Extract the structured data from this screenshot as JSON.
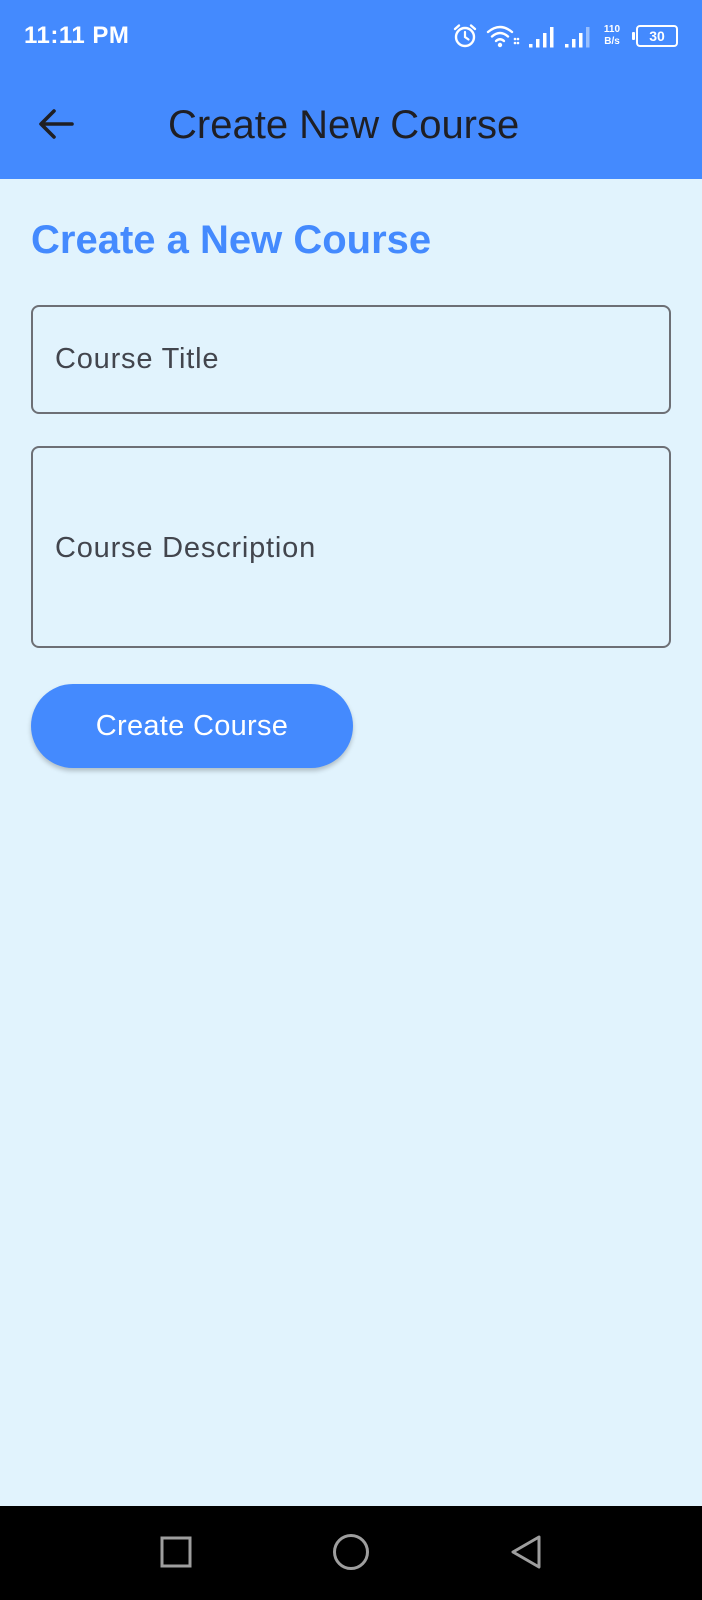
{
  "status_bar": {
    "time": "11:11 PM",
    "net_speed_value": "110",
    "net_speed_unit": "B/s",
    "battery": "30",
    "icons": [
      "alarm-icon",
      "wifi-icon",
      "signal-icon",
      "signal-icon"
    ]
  },
  "app_bar": {
    "title": "Create New Course",
    "back_icon": "arrow-left-icon",
    "color": "#448afe"
  },
  "form": {
    "heading": "Create a New Course",
    "title_placeholder": "Course Title",
    "title_value": "",
    "description_placeholder": "Course Description",
    "description_value": "",
    "submit_label": "Create Course"
  },
  "nav_bar": {
    "icons": [
      "recent-apps-icon",
      "home-icon",
      "back-icon"
    ]
  },
  "colors": {
    "accent": "#448afe",
    "background": "#e1f3fd"
  }
}
